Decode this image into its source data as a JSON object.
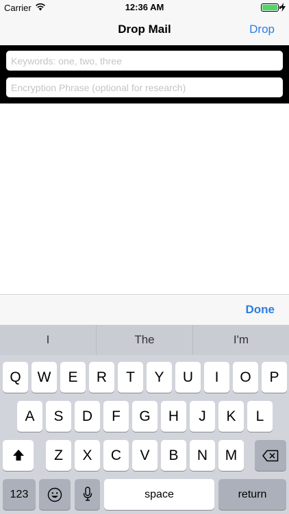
{
  "status": {
    "carrier": "Carrier",
    "time": "12:36 AM"
  },
  "nav": {
    "title": "Drop Mail",
    "action": "Drop"
  },
  "fields": {
    "keywords_placeholder": "Keywords: one, two, three",
    "phrase_placeholder": "Encryption Phrase (optional for research)"
  },
  "accessory": {
    "done": "Done"
  },
  "suggestions": [
    "I",
    "The",
    "I'm"
  ],
  "keyboard": {
    "row1": [
      "Q",
      "W",
      "E",
      "R",
      "T",
      "Y",
      "U",
      "I",
      "O",
      "P"
    ],
    "row2": [
      "A",
      "S",
      "D",
      "F",
      "G",
      "H",
      "J",
      "K",
      "L"
    ],
    "row3": [
      "Z",
      "X",
      "C",
      "V",
      "B",
      "N",
      "M"
    ],
    "numbers_label": "123",
    "space_label": "space",
    "return_label": "return"
  },
  "colors": {
    "accent": "#2a7de1",
    "battery": "#4cd964"
  }
}
